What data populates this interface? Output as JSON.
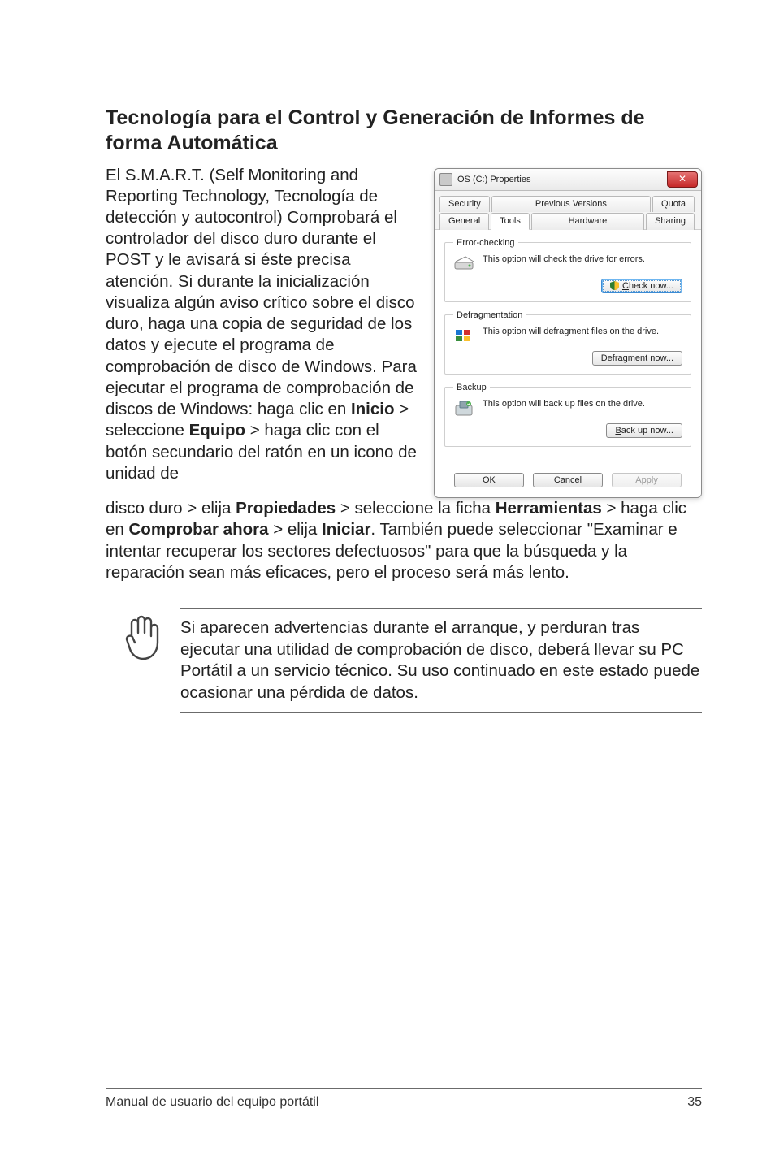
{
  "heading": "Tecnología para el Control y Generación de Informes de forma Automática",
  "body": {
    "p1_a": "El S.M.A.R.T. (Self Monitoring and Reporting Technology, Tecnología de detección y autocontrol) Comprobará el controlador del disco duro durante el POST y le avisará si éste precisa atención. Si durante la inicialización visualiza algún aviso crítico sobre el disco duro, haga una copia de seguridad de los datos y ejecute el programa de comprobación de disco de Windows. Para ejecutar el programa de comprobación de discos de Windows: haga clic en ",
    "inicio": "Inicio",
    "gt1": " > seleccione ",
    "equipo": "Equipo",
    "gt2": " > haga clic con el botón secundario del ratón en un icono de unidad de ",
    "p2_a": "disco duro > elija ",
    "propiedades": "Propiedades",
    "p2_b": " > seleccione la ficha ",
    "herramientas": "Herramientas",
    "p2_c": " > haga clic en ",
    "comprobar": "Comprobar ahora",
    "p2_d": " > elija ",
    "iniciar": "Iniciar",
    "p2_e": ". También puede seleccionar \"Examinar e intentar recuperar los sectores defectuosos\" para que la búsqueda y la reparación sean más eficaces, pero el proceso será más lento."
  },
  "note": "Si aparecen advertencias durante el arranque, y perduran tras ejecutar una utilidad de comprobación de disco, deberá llevar su PC Portátil a un servicio técnico. Su uso continuado en este estado puede ocasionar una pérdida de datos.",
  "footer": {
    "left": "Manual de usuario del equipo portátil",
    "page": "35"
  },
  "dialog": {
    "title": "OS (C:) Properties",
    "tabs_row1": [
      "Security",
      "Previous Versions",
      "Quota"
    ],
    "tabs_row2": [
      "General",
      "Tools",
      "Hardware",
      "Sharing"
    ],
    "groups": {
      "error": {
        "legend": "Error-checking",
        "desc": "This option will check the drive for errors.",
        "button_pre": "C",
        "button_rest": "heck now..."
      },
      "defrag": {
        "legend": "Defragmentation",
        "desc": "This option will defragment files on the drive.",
        "button_pre": "D",
        "button_rest": "efragment now..."
      },
      "backup": {
        "legend": "Backup",
        "desc": "This option will back up files on the drive.",
        "button_pre": "B",
        "button_rest": "ack up now..."
      }
    },
    "buttons": {
      "ok": "OK",
      "cancel": "Cancel",
      "apply": "Apply"
    }
  }
}
